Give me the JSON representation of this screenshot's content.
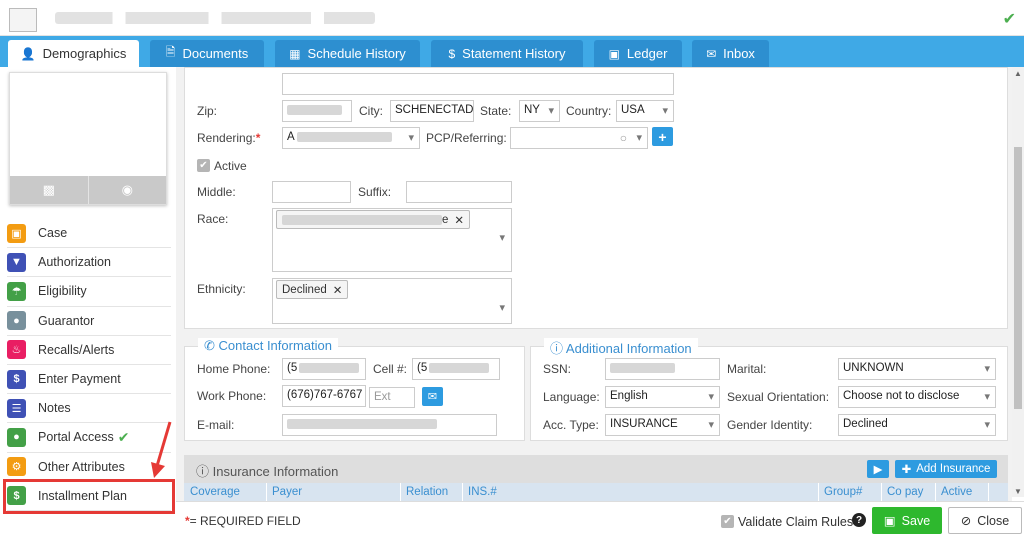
{
  "header": {
    "status_icon": "check-icon"
  },
  "tabs": [
    {
      "label": "Demographics",
      "icon": "user-icon",
      "active": true
    },
    {
      "label": "Documents",
      "icon": "document-icon"
    },
    {
      "label": "Schedule History",
      "icon": "calendar-icon"
    },
    {
      "label": "Statement History",
      "icon": "dollar-icon"
    },
    {
      "label": "Ledger",
      "icon": "folder-icon"
    },
    {
      "label": "Inbox",
      "icon": "envelope-icon"
    }
  ],
  "sidebar": {
    "items": [
      {
        "label": "Case",
        "color": "#f39c12",
        "icon": "case-icon"
      },
      {
        "label": "Authorization",
        "color": "#3f51b5",
        "icon": "shield-icon"
      },
      {
        "label": "Eligibility",
        "color": "#43a047",
        "icon": "umbrella-icon"
      },
      {
        "label": "Guarantor",
        "color": "#78909c",
        "icon": "group-icon"
      },
      {
        "label": "Recalls/Alerts",
        "color": "#e91e63",
        "icon": "bell-icon"
      },
      {
        "label": "Enter Payment",
        "color": "#3f51b5",
        "icon": "dollar-icon"
      },
      {
        "label": "Notes",
        "color": "#3f51b5",
        "icon": "notes-icon"
      },
      {
        "label": "Portal Access",
        "color": "#43a047",
        "icon": "globe-icon"
      },
      {
        "label": "Other Attributes",
        "color": "#f39c12",
        "icon": "gear-icon"
      },
      {
        "label": "Installment Plan",
        "color": "#43a047",
        "icon": "dollar-icon"
      }
    ]
  },
  "form": {
    "zip_label": "Zip:",
    "city_label": "City:",
    "city_value": "SCHENECTADY",
    "state_label": "State:",
    "state_value": "NY",
    "country_label": "Country:",
    "country_value": "USA",
    "rendering_label": "Rendering:",
    "rendering_value_prefix": "A",
    "pcp_label": "PCP/Referring:",
    "active_label": "Active",
    "middle_label": "Middle:",
    "suffix_label": "Suffix:",
    "race_label": "Race:",
    "race_chip_suffix": "e",
    "ethnicity_label": "Ethnicity:",
    "ethnicity_chip": "Declined"
  },
  "contact": {
    "title": "Contact Information",
    "home_phone_label": "Home Phone:",
    "home_phone_prefix": "(5",
    "cell_label": "Cell #:",
    "cell_prefix": "(5",
    "work_phone_label": "Work Phone:",
    "work_phone_value": "(676)767-6767",
    "ext_placeholder": "Ext",
    "email_label": "E-mail:"
  },
  "additional": {
    "title": "Additional Information",
    "ssn_label": "SSN:",
    "marital_label": "Marital:",
    "marital_value": "UNKNOWN",
    "language_label": "Language:",
    "language_value": "English",
    "orientation_label": "Sexual Orientation:",
    "orientation_value": "Choose not to disclose",
    "acc_type_label": "Acc. Type:",
    "acc_type_value": "INSURANCE",
    "gender_label": "Gender Identity:",
    "gender_value": "Declined"
  },
  "insurance": {
    "title": "Insurance Information",
    "add_label": "Add Insurance",
    "columns": [
      "Coverage",
      "Payer",
      "Relation",
      "INS.#",
      "Group#",
      "Co pay",
      "Active"
    ]
  },
  "footer": {
    "required_star": "*",
    "required_text": "= REQUIRED FIELD",
    "validate_label": "Validate Claim Rules",
    "save_label": "Save",
    "close_label": "Close"
  }
}
